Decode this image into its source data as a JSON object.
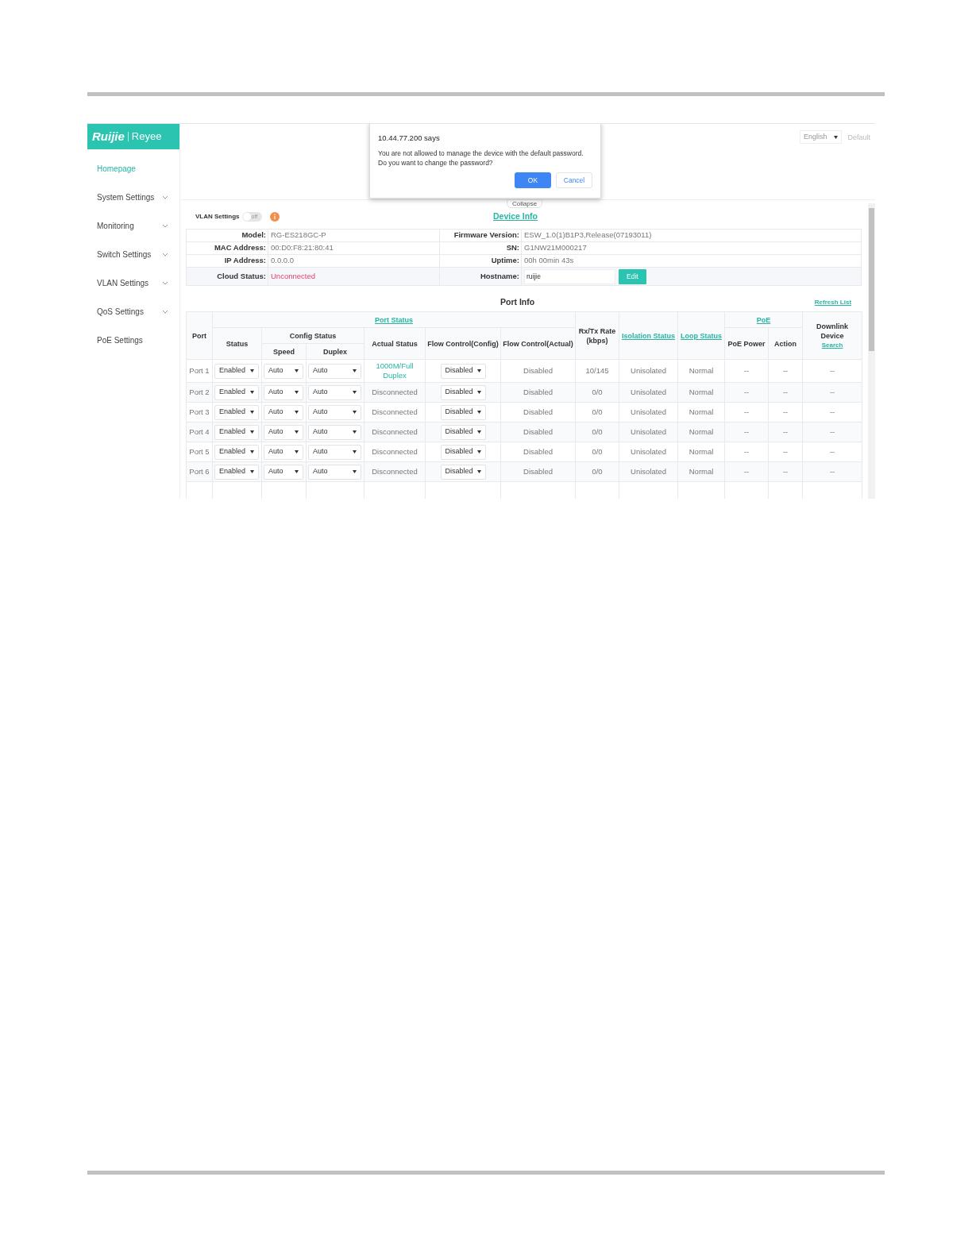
{
  "logo": {
    "left": "Ruijie",
    "right": "Reyee"
  },
  "sidebar": {
    "items": [
      {
        "label": "Homepage",
        "selected": true,
        "has_submenu": false
      },
      {
        "label": "System Settings",
        "selected": false,
        "has_submenu": true
      },
      {
        "label": "Monitoring",
        "selected": false,
        "has_submenu": true
      },
      {
        "label": "Switch Settings",
        "selected": false,
        "has_submenu": true
      },
      {
        "label": "VLAN Settings",
        "selected": false,
        "has_submenu": true
      },
      {
        "label": "QoS Settings",
        "selected": false,
        "has_submenu": true
      },
      {
        "label": "PoE Settings",
        "selected": false,
        "has_submenu": false
      }
    ]
  },
  "header": {
    "language": "English",
    "default_link": "Default",
    "collapse": "Collapse"
  },
  "dialog": {
    "title": "10.44.77.200 says",
    "message": "You are not allowed to manage the device with the default password. Do you want to change the password?",
    "buttons": [
      {
        "label": "OK",
        "primary": true
      },
      {
        "label": "Cancel",
        "primary": false
      }
    ]
  },
  "vlan": {
    "label": "VLAN Settings",
    "toggle": {
      "on": false,
      "label": "off"
    }
  },
  "device_info": {
    "title": "Device Info",
    "rows": [
      [
        {
          "label": "Model:",
          "value": "RG-ES218GC-P",
          "kind": "text"
        },
        {
          "label": "Firmware Version:",
          "value": "ESW_1.0(1)B1P3,Release(07193011)",
          "kind": "text"
        }
      ],
      [
        {
          "label": "MAC Address:",
          "value": "00:D0:F8:21:80:41",
          "kind": "text"
        },
        {
          "label": "SN:",
          "value": "G1NW21M000217",
          "kind": "text"
        }
      ],
      [
        {
          "label": "IP Address:",
          "value": "0.0.0.0",
          "kind": "text"
        },
        {
          "label": "Uptime:",
          "value": "00h 00min 43s",
          "kind": "text"
        }
      ],
      [
        {
          "label": "Cloud Status:",
          "value": "Unconnected",
          "kind": "alert"
        },
        {
          "label": "Hostname:",
          "value": "ruijie",
          "kind": "input",
          "button": "Edit"
        }
      ]
    ]
  },
  "port_info": {
    "title": "Port Info",
    "refresh": "Refresh List",
    "headers": {
      "port": {
        "text": "Port",
        "link": false
      },
      "port_status": {
        "text": "Port Status",
        "link": true
      },
      "status": {
        "text": "Status",
        "link": false
      },
      "config_status": {
        "text": "Config Status",
        "link": false
      },
      "speed": {
        "text": "Speed",
        "link": false
      },
      "duplex": {
        "text": "Duplex",
        "link": false
      },
      "actual": {
        "text": "Actual Status",
        "link": false
      },
      "flow_config": {
        "text": "Flow Control(Config)",
        "link": false
      },
      "flow_actual": {
        "text": "Flow Control(Actual)",
        "link": false
      },
      "rate": {
        "text": "Rx/Tx Rate (kbps)",
        "link": false
      },
      "isolation": {
        "text": "Isolation Status",
        "link": true
      },
      "loop": {
        "text": "Loop Status",
        "link": true
      },
      "poe": {
        "text": "PoE",
        "link": true
      },
      "poe_power": {
        "text": "PoE Power",
        "link": false
      },
      "action": {
        "text": "Action",
        "link": false
      },
      "downlink": {
        "text": "Downlink Device",
        "link": false
      },
      "search": {
        "text": "Search",
        "link": true
      }
    },
    "rows": [
      {
        "port": "Port 1",
        "status": "Enabled",
        "speed": "Auto",
        "duplex": "Auto",
        "actual": "1000M/Full Duplex",
        "connected": true,
        "flow_config": "Disabled",
        "flow_actual": "Disabled",
        "rate": "10/145",
        "isolation": "Unisolated",
        "loop": "Normal",
        "poe_power": "--",
        "action": "--",
        "downlink": "--"
      },
      {
        "port": "Port 2",
        "status": "Enabled",
        "speed": "Auto",
        "duplex": "Auto",
        "actual": "Disconnected",
        "connected": false,
        "flow_config": "Disabled",
        "flow_actual": "Disabled",
        "rate": "0/0",
        "isolation": "Unisolated",
        "loop": "Normal",
        "poe_power": "--",
        "action": "--",
        "downlink": "--"
      },
      {
        "port": "Port 3",
        "status": "Enabled",
        "speed": "Auto",
        "duplex": "Auto",
        "actual": "Disconnected",
        "connected": false,
        "flow_config": "Disabled",
        "flow_actual": "Disabled",
        "rate": "0/0",
        "isolation": "Unisolated",
        "loop": "Normal",
        "poe_power": "--",
        "action": "--",
        "downlink": "--"
      },
      {
        "port": "Port 4",
        "status": "Enabled",
        "speed": "Auto",
        "duplex": "Auto",
        "actual": "Disconnected",
        "connected": false,
        "flow_config": "Disabled",
        "flow_actual": "Disabled",
        "rate": "0/0",
        "isolation": "Unisolated",
        "loop": "Normal",
        "poe_power": "--",
        "action": "--",
        "downlink": "--"
      },
      {
        "port": "Port 5",
        "status": "Enabled",
        "speed": "Auto",
        "duplex": "Auto",
        "actual": "Disconnected",
        "connected": false,
        "flow_config": "Disabled",
        "flow_actual": "Disabled",
        "rate": "0/0",
        "isolation": "Unisolated",
        "loop": "Normal",
        "poe_power": "--",
        "action": "--",
        "downlink": "--"
      },
      {
        "port": "Port 6",
        "status": "Enabled",
        "speed": "Auto",
        "duplex": "Auto",
        "actual": "Disconnected",
        "connected": false,
        "flow_config": "Disabled",
        "flow_actual": "Disabled",
        "rate": "0/0",
        "isolation": "Unisolated",
        "loop": "Normal",
        "poe_power": "--",
        "action": "--",
        "downlink": "--"
      }
    ]
  }
}
